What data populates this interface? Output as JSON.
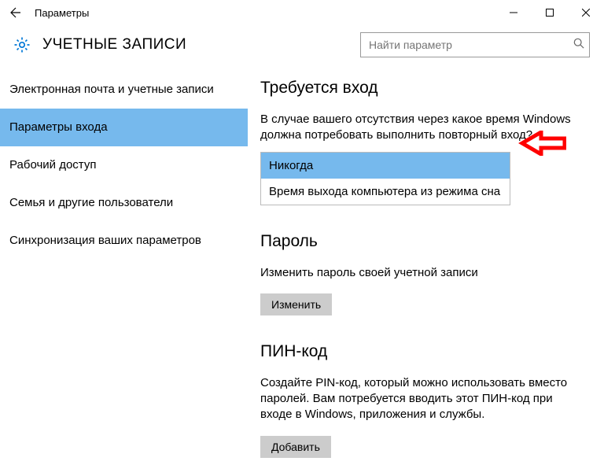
{
  "window": {
    "title": "Параметры"
  },
  "header": {
    "page_title": "УЧЕТНЫЕ ЗАПИСИ",
    "search_placeholder": "Найти параметр"
  },
  "sidebar": {
    "items": [
      {
        "label": "Электронная почта и учетные записи",
        "selected": false
      },
      {
        "label": "Параметры входа",
        "selected": true
      },
      {
        "label": "Рабочий доступ",
        "selected": false
      },
      {
        "label": "Семья и другие пользователи",
        "selected": false
      },
      {
        "label": "Синхронизация ваших параметров",
        "selected": false
      }
    ]
  },
  "main": {
    "signin": {
      "heading": "Требуется вход",
      "desc": "В случае вашего отсутствия через какое время Windows должна потребовать выполнить повторный вход?",
      "options": [
        "Никогда",
        "Время выхода компьютера из режима сна"
      ],
      "selected_index": 0
    },
    "password": {
      "heading": "Пароль",
      "desc": "Изменить пароль своей учетной записи",
      "button": "Изменить"
    },
    "pin": {
      "heading": "ПИН-код",
      "desc": "Создайте PIN-код, который можно использовать вместо паролей. Вам потребуется вводить этот ПИН-код при входе в Windows, приложения и службы.",
      "button": "Добавить"
    }
  }
}
